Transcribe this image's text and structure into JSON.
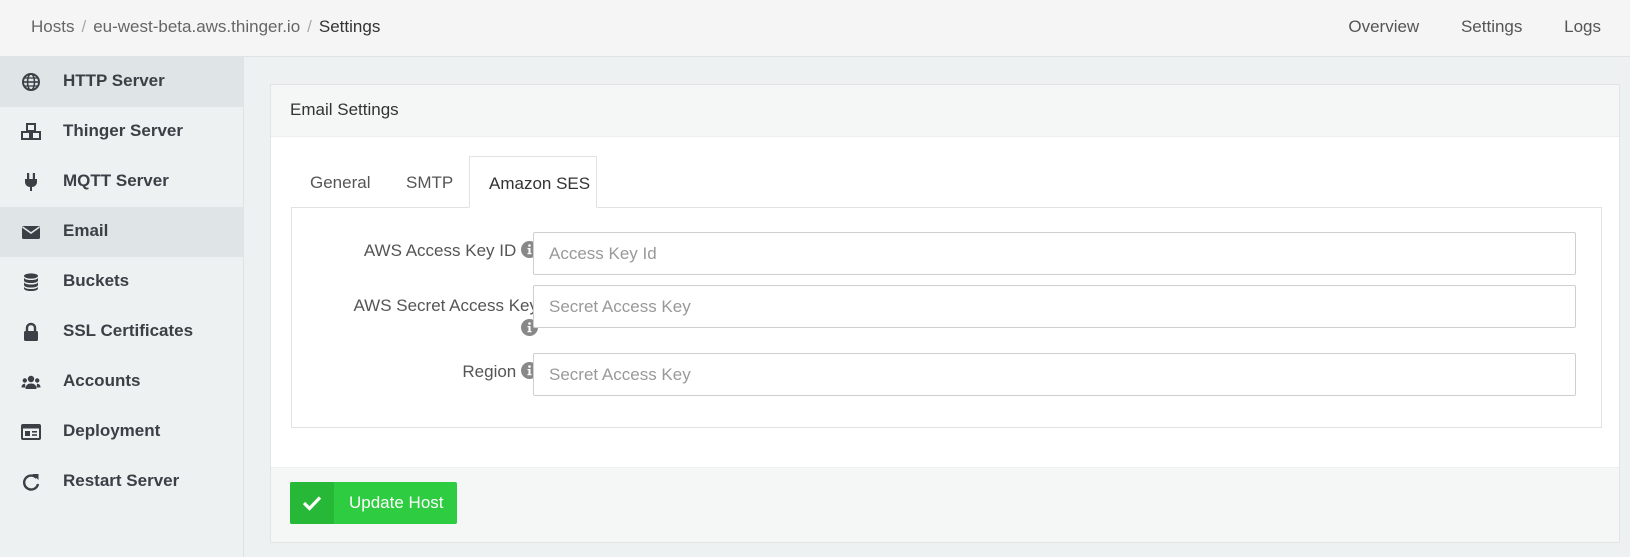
{
  "breadcrumb": {
    "items": [
      "Hosts",
      "eu-west-beta.aws.thinger.io"
    ],
    "current": "Settings"
  },
  "topnav": [
    "Overview",
    "Settings",
    "Logs"
  ],
  "sidebar": {
    "items": [
      {
        "label": "HTTP Server",
        "icon": "globe-icon"
      },
      {
        "label": "Thinger Server",
        "icon": "cubes-icon"
      },
      {
        "label": "MQTT Server",
        "icon": "plug-icon"
      },
      {
        "label": "Email",
        "icon": "envelope-icon",
        "active": true
      },
      {
        "label": "Buckets",
        "icon": "database-icon"
      },
      {
        "label": "SSL Certificates",
        "icon": "lock-icon"
      },
      {
        "label": "Accounts",
        "icon": "users-icon"
      },
      {
        "label": "Deployment",
        "icon": "id-card-icon"
      },
      {
        "label": "Restart Server",
        "icon": "redo-icon"
      }
    ]
  },
  "card": {
    "title": "Email Settings",
    "tabs": [
      "General",
      "SMTP",
      "Amazon SES"
    ],
    "active_tab": "Amazon SES",
    "fields": [
      {
        "label": "AWS Access Key ID",
        "placeholder": "Access Key Id",
        "value": ""
      },
      {
        "label": "AWS Secret Access Key",
        "placeholder": "Secret Access Key",
        "value": ""
      },
      {
        "label": "Region",
        "placeholder": "Secret Access Key",
        "value": ""
      }
    ],
    "submit_label": "Update Host"
  },
  "colors": {
    "accent_green": "#2ecc40",
    "sidebar_active": "#dfe5e7"
  }
}
